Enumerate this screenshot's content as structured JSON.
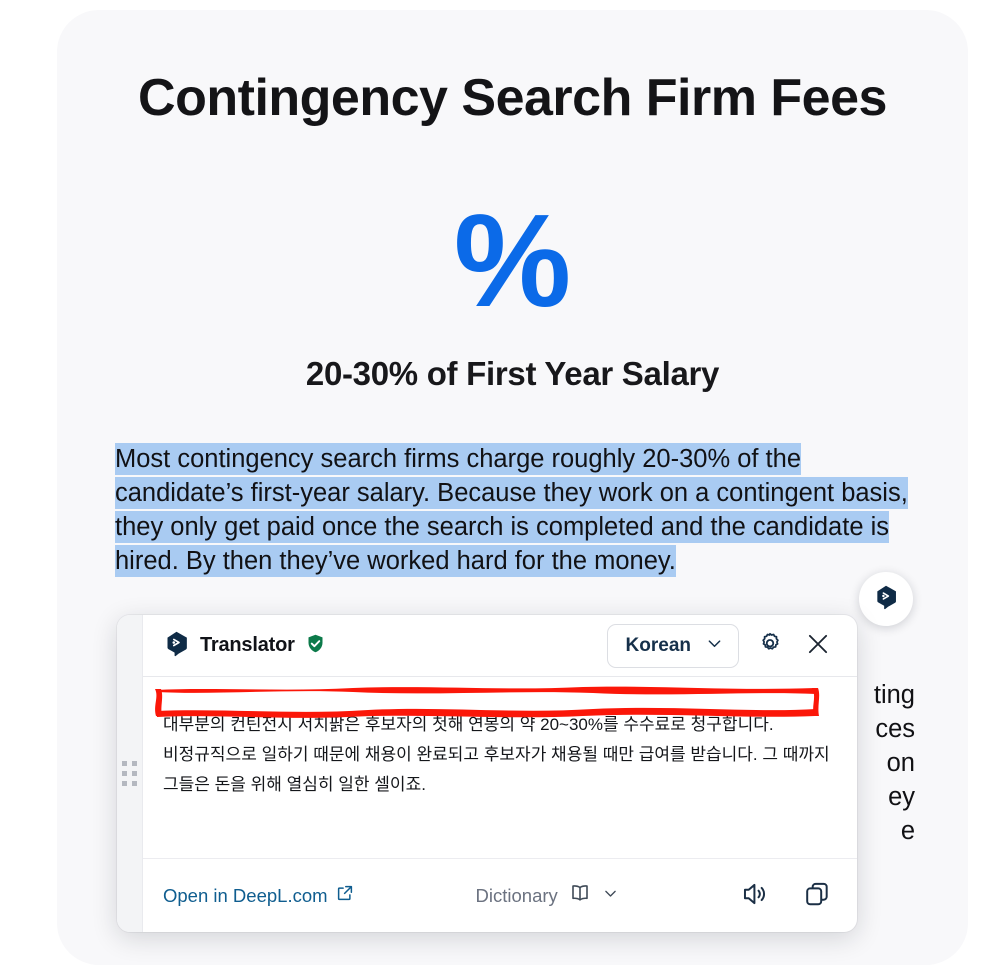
{
  "page": {
    "background": "#ffffff",
    "card_background": "#f8f8fa",
    "accent_blue": "#0b6ae8",
    "selection_highlight": "#a9cbf2",
    "annotation_color": "#ff1a0f"
  },
  "slide": {
    "title": "Contingency Search Firm Fees",
    "percent_symbol": "%",
    "subtitle": "20-30% of First Year Salary",
    "body_text": "Most contingency search firms charge roughly 20-30% of the candidate’s first-year salary. Because they work on a contingent basis, they only get paid once the search is completed and the candidate is hired. By then they’ve worked hard for the money."
  },
  "background_fragments": {
    "line1": "ting",
    "line2": "ces",
    "line3": "on",
    "line4": "ey",
    "line5": "e"
  },
  "floating_button": {
    "icon": "deepl-logo-icon"
  },
  "popup": {
    "header": {
      "logo_icon": "deepl-logo-icon",
      "brand_name": "Translator",
      "verified_icon": "green-shield-check-icon",
      "language": "Korean",
      "language_chevron_icon": "chevron-down-icon",
      "settings_icon": "gear-icon",
      "close_icon": "close-icon"
    },
    "translation": {
      "line1": "대부분의 컨틴전시 서치팕은 후보자의 첫해 연봉의 약 20~30%를 수수료로 청구합니다.",
      "rest": "비정규직으로 일하기 때문에 채용이 완료되고 후보자가 채용될 때만 급여를 받습니다. 그 때까지 그들은 돈을 위해 열심히 일한 셀이죠."
    },
    "footer": {
      "open_link": "Open in DeepL.com",
      "open_link_icon": "external-link-icon",
      "dictionary_label": "Dictionary",
      "dictionary_icon": "book-icon",
      "dictionary_chevron_icon": "chevron-down-icon",
      "speaker_icon": "speaker-volume-icon",
      "copy_icon": "copy-icon"
    },
    "drag_handle_icon": "drag-dots-icon"
  }
}
